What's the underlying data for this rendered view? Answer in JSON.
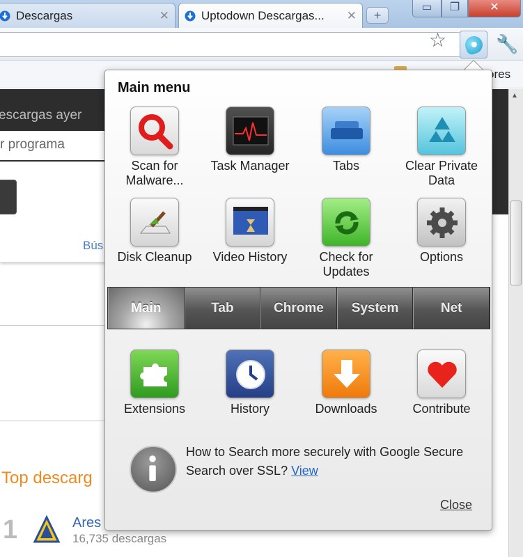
{
  "browser": {
    "tabs": [
      {
        "title": "Descargas",
        "close": "✕",
        "active": false
      },
      {
        "title": "Uptodown Descargas...",
        "close": "✕",
        "active": true
      }
    ],
    "new_tab": "+",
    "window_controls": {
      "minimize": "▭",
      "maximize": "❐",
      "close": "✕"
    },
    "star_glyph": "☆",
    "wrench_glyph": "🔧",
    "bookmark_partial": "ores"
  },
  "page": {
    "yesterday_text": "escargas ayer",
    "search_placeholder": "r programa",
    "search_link": "Bús",
    "top_heading": "Top descarg",
    "rank": "1",
    "app_name": "Ares",
    "app_downloads": "16,735 descargas"
  },
  "popup": {
    "title": "Main menu",
    "top_tiles": [
      {
        "label": "Scan for Malware...",
        "icon": "magnifier-icon"
      },
      {
        "label": "Task Manager",
        "icon": "task-manager-icon"
      },
      {
        "label": "Tabs",
        "icon": "tabs-icon"
      },
      {
        "label": "Clear Private Data",
        "icon": "recycle-icon"
      },
      {
        "label": "Disk Cleanup",
        "icon": "broom-icon"
      },
      {
        "label": "Video History",
        "icon": "clapperboard-icon"
      },
      {
        "label": "Check for Updates",
        "icon": "refresh-arrows-icon"
      },
      {
        "label": "Options",
        "icon": "gear-icon"
      }
    ],
    "category_tabs": [
      "Main",
      "Tab",
      "Chrome",
      "System",
      "Net"
    ],
    "selected_tab": "Main",
    "bottom_tiles": [
      {
        "label": "Extensions",
        "icon": "puzzle-icon"
      },
      {
        "label": "History",
        "icon": "clock-icon"
      },
      {
        "label": "Downloads",
        "icon": "download-arrow-icon"
      },
      {
        "label": "Contribute",
        "icon": "heart-icon"
      }
    ],
    "tip": {
      "text": "How to Search more securely with Google Secure Search over SSL?",
      "link": "View"
    },
    "close_label": "Close"
  }
}
